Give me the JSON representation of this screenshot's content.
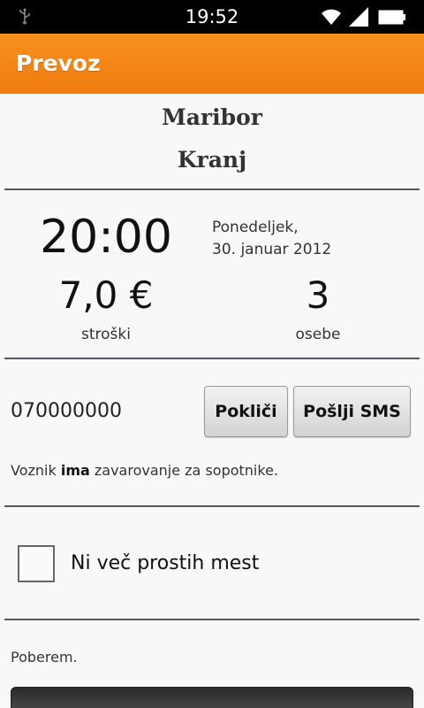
{
  "status_bar": {
    "time": "19:52",
    "icons": [
      "usb-icon",
      "wifi-icon",
      "signal-icon",
      "battery-icon"
    ]
  },
  "action_bar": {
    "title": "Prevoz",
    "color": "#f5891a"
  },
  "route": {
    "from": "Maribor",
    "to": "Kranj"
  },
  "ride": {
    "time": "20:00",
    "day": "Ponedeljek,",
    "date": "30. januar 2012",
    "cost": "7,0 €",
    "cost_label": "stroški",
    "people": "3",
    "people_label": "osebe"
  },
  "contact": {
    "phone": "070000000",
    "call_label": "Pokliči",
    "sms_label": "Pošlji SMS"
  },
  "insurance": {
    "prefix": "Voznik ",
    "emphasis": "ima",
    "suffix": " zavarovanje za sopotnike."
  },
  "full_checkbox": {
    "label": "Ni več prostih mest",
    "checked": false
  },
  "comment": "Poberem."
}
